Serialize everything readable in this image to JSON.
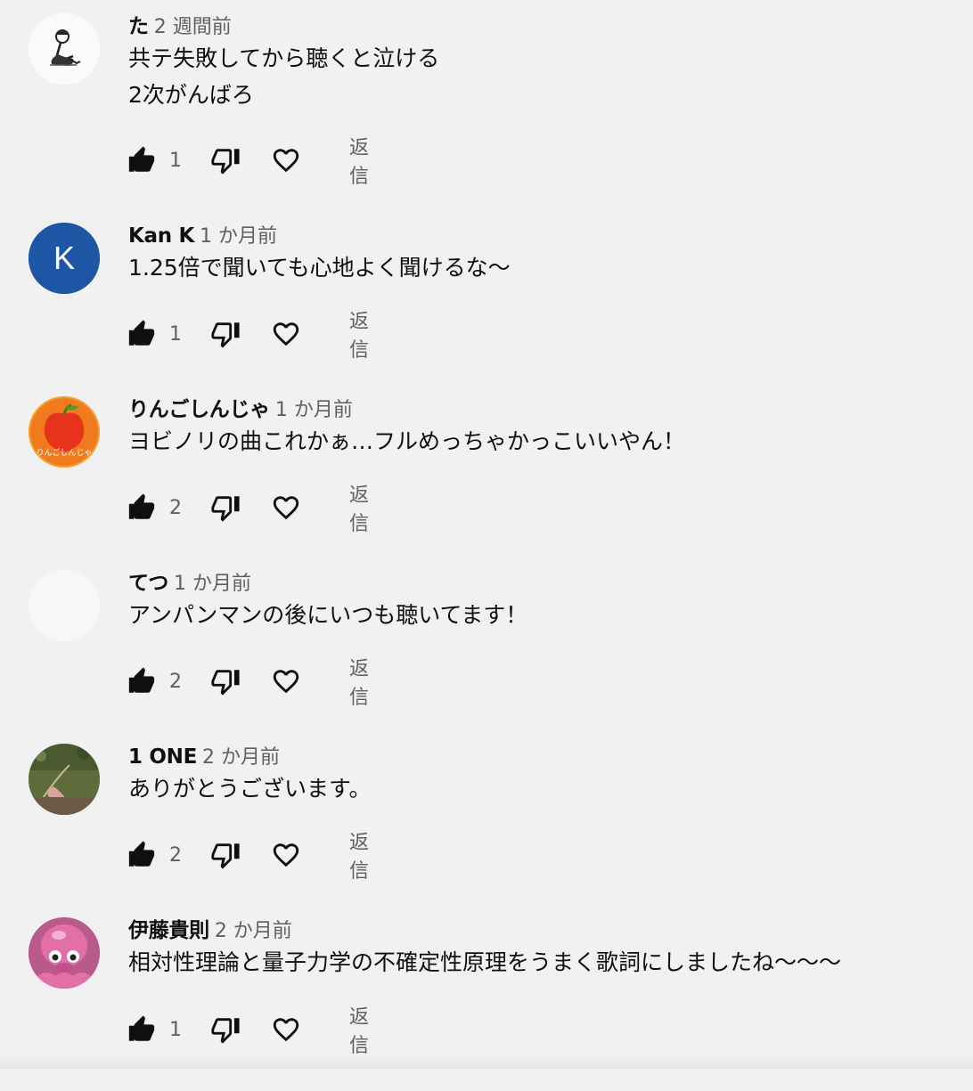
{
  "comments": [
    {
      "author": "た",
      "time": "2 週間前",
      "text": "共テ失敗してから聴くと泣ける\n2次がんばろ",
      "likes": "1",
      "reply": "返信",
      "avatar": "sketch-figure-avatar"
    },
    {
      "author": "Kan K",
      "time": "1 か月前",
      "text": "1.25倍で聞いても心地よく聞けるな〜",
      "likes": "1",
      "reply": "返信",
      "avatar_letter": "K",
      "avatar_color": "#1c56a4"
    },
    {
      "author": "りんごしんじゃ",
      "time": "1 か月前",
      "text": "ヨビノリの曲これかぁ…フルめっちゃかっこいいやん！",
      "likes": "2",
      "reply": "返信",
      "avatar_label": "りんごしんじゃ",
      "avatar_color": "#f07a1e"
    },
    {
      "author": "てつ",
      "time": "1 か月前",
      "text": "アンパンマンの後にいつも聴いてます！",
      "likes": "2",
      "reply": "返信",
      "avatar_color": "#f7f7f7"
    },
    {
      "author": "1 ONE",
      "time": "2 か月前",
      "text": "ありがとうございます。",
      "likes": "2",
      "reply": "返信",
      "avatar": "outdoor-photo-avatar"
    },
    {
      "author": "伊藤貴則",
      "time": "2 か月前",
      "text": "相対性理論と量子力学の不確定性原理をうまく歌詞にしましたね〜〜〜",
      "likes": "1",
      "reply": "返信",
      "avatar": "pink-octopus-avatar"
    }
  ],
  "colors": {
    "background": "#f1f1f1",
    "text_primary": "#0f0f0f",
    "text_secondary": "#606060"
  }
}
